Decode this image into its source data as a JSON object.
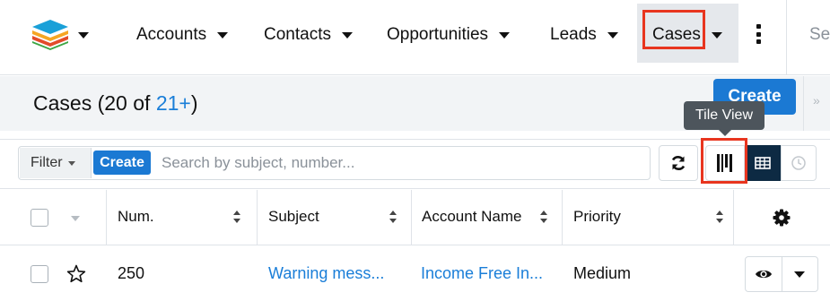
{
  "nav": {
    "items": [
      {
        "label": "Accounts"
      },
      {
        "label": "Contacts"
      },
      {
        "label": "Opportunities"
      },
      {
        "label": "Leads"
      },
      {
        "label": "Cases"
      }
    ],
    "search_clipped": "Se"
  },
  "header": {
    "title": "Cases",
    "count_prefix": "(20 of ",
    "count_link": "21+",
    "count_suffix": ")",
    "create_label": "Create",
    "collapse_glyph": "»"
  },
  "tooltip": {
    "label": "Tile View"
  },
  "filter": {
    "dropdown_label": "Filter",
    "create_label": "Create",
    "search_placeholder": "Search by subject, number..."
  },
  "table": {
    "columns": [
      "Num.",
      "Subject",
      "Account Name",
      "Priority"
    ],
    "rows": [
      {
        "num": "250",
        "subject": "Warning mess...",
        "account": "Income Free In...",
        "priority": "Medium"
      }
    ]
  },
  "colors": {
    "accent": "#1b79d3",
    "highlight_box": "#e8351f",
    "dark_button": "#0d2a43"
  },
  "icons": [
    "app-logo-icon",
    "more-vertical-icon",
    "refresh-icon",
    "tile-view-icon",
    "list-view-icon",
    "history-clock-icon",
    "sort-icon",
    "gear-icon",
    "star-icon",
    "eye-icon",
    "caret-down-icon"
  ]
}
